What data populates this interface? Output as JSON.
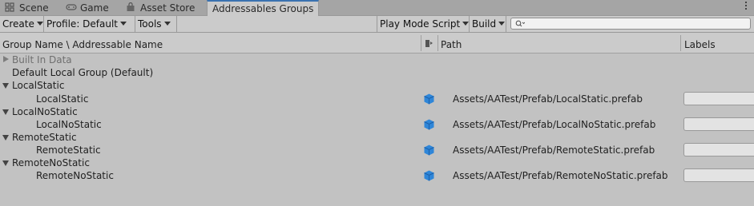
{
  "tabs": [
    {
      "label": "Scene",
      "icon": "grid-icon"
    },
    {
      "label": "Game",
      "icon": "gamepad-icon"
    },
    {
      "label": "Asset Store",
      "icon": "bag-icon"
    },
    {
      "label": "Addressables Groups",
      "active": true
    }
  ],
  "toolbar": {
    "create": "Create",
    "profile": "Profile: Default",
    "tools": "Tools",
    "play_mode_script": "Play Mode Script",
    "build": "Build",
    "search_placeholder": ""
  },
  "columns": {
    "group_name": "Group Name \\ Addressable Name",
    "path": "Path",
    "labels": "Labels"
  },
  "rows": [
    {
      "name": "Built In Data",
      "type": "group-collapsed"
    },
    {
      "name": "Default Local Group (Default)",
      "type": "group-plain"
    },
    {
      "name": "LocalStatic",
      "type": "group-expanded"
    },
    {
      "name": "LocalStatic",
      "type": "entry",
      "path": "Assets/AATest/Prefab/LocalStatic.prefab"
    },
    {
      "name": "LocalNoStatic",
      "type": "group-expanded"
    },
    {
      "name": "LocalNoStatic",
      "type": "entry",
      "path": "Assets/AATest/Prefab/LocalNoStatic.prefab"
    },
    {
      "name": "RemoteStatic",
      "type": "group-expanded"
    },
    {
      "name": "RemoteStatic",
      "type": "entry",
      "path": "Assets/AATest/Prefab/RemoteStatic.prefab"
    },
    {
      "name": "RemoteNoStatic",
      "type": "group-expanded"
    },
    {
      "name": "RemoteNoStatic",
      "type": "entry",
      "path": "Assets/AATest/Prefab/RemoteNoStatic.prefab"
    }
  ],
  "colors": {
    "accent": "#3a72b0",
    "prefab_icon": "#2f86d8"
  }
}
